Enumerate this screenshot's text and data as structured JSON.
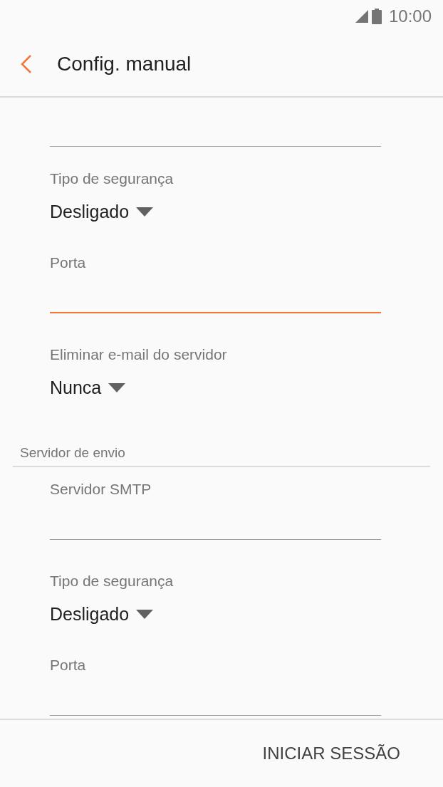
{
  "status_bar": {
    "time": "10:00"
  },
  "header": {
    "title": "Config. manual"
  },
  "items": [
    {
      "kind": "field",
      "focused": false
    },
    {
      "kind": "dropdown",
      "label": "Tipo de segurança",
      "value": "Desligado"
    },
    {
      "kind": "field",
      "label": "Porta",
      "focused": true
    },
    {
      "kind": "dropdown",
      "label": "Eliminar e-mail do servidor",
      "value": "Nunca"
    },
    {
      "kind": "section",
      "title": "Servidor de envio"
    },
    {
      "kind": "field",
      "label": "Servidor SMTP",
      "focused": false
    },
    {
      "kind": "dropdown",
      "label": "Tipo de segurança",
      "value": "Desligado"
    },
    {
      "kind": "field",
      "label": "Porta",
      "focused": false
    }
  ],
  "footer": {
    "button": "INICIAR SESSÃO"
  }
}
